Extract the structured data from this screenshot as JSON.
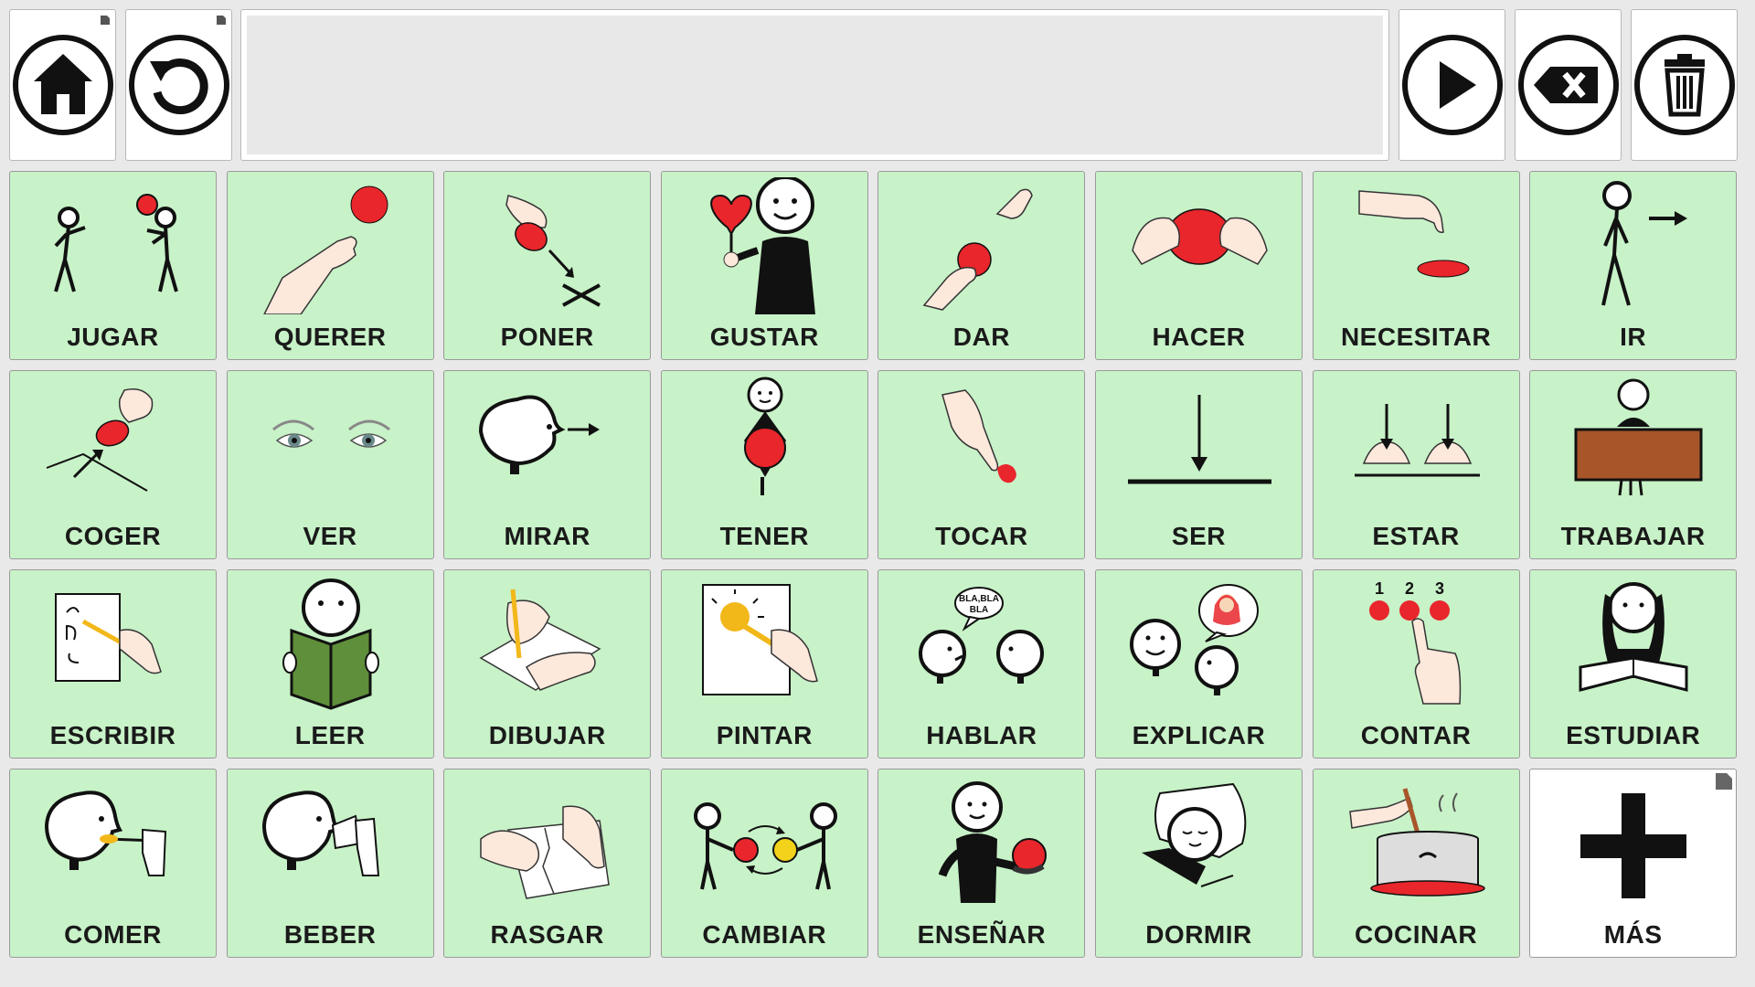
{
  "toolbar": {
    "home_icon": "home-icon",
    "back_icon": "undo-icon",
    "play_icon": "play-icon",
    "backspace_icon": "backspace-icon",
    "trash_icon": "trash-icon",
    "sentence_text": ""
  },
  "cells": [
    {
      "label": "JUGAR",
      "icon": "jugar-pictogram"
    },
    {
      "label": "QUERER",
      "icon": "querer-pictogram"
    },
    {
      "label": "PONER",
      "icon": "poner-pictogram"
    },
    {
      "label": "GUSTAR",
      "icon": "gustar-pictogram"
    },
    {
      "label": "DAR",
      "icon": "dar-pictogram"
    },
    {
      "label": "HACER",
      "icon": "hacer-pictogram"
    },
    {
      "label": "NECESITAR",
      "icon": "necesitar-pictogram"
    },
    {
      "label": "IR",
      "icon": "ir-pictogram"
    },
    {
      "label": "COGER",
      "icon": "coger-pictogram"
    },
    {
      "label": "VER",
      "icon": "ver-pictogram"
    },
    {
      "label": "MIRAR",
      "icon": "mirar-pictogram"
    },
    {
      "label": "TENER",
      "icon": "tener-pictogram"
    },
    {
      "label": "TOCAR",
      "icon": "tocar-pictogram"
    },
    {
      "label": "SER",
      "icon": "ser-pictogram"
    },
    {
      "label": "ESTAR",
      "icon": "estar-pictogram"
    },
    {
      "label": "TRABAJAR",
      "icon": "trabajar-pictogram"
    },
    {
      "label": "ESCRIBIR",
      "icon": "escribir-pictogram"
    },
    {
      "label": "LEER",
      "icon": "leer-pictogram"
    },
    {
      "label": "DIBUJAR",
      "icon": "dibujar-pictogram"
    },
    {
      "label": "PINTAR",
      "icon": "pintar-pictogram"
    },
    {
      "label": "HABLAR",
      "icon": "hablar-pictogram"
    },
    {
      "label": "EXPLICAR",
      "icon": "explicar-pictogram"
    },
    {
      "label": "CONTAR",
      "icon": "contar-pictogram"
    },
    {
      "label": "ESTUDIAR",
      "icon": "estudiar-pictogram"
    },
    {
      "label": "COMER",
      "icon": "comer-pictogram"
    },
    {
      "label": "BEBER",
      "icon": "beber-pictogram"
    },
    {
      "label": "RASGAR",
      "icon": "rasgar-pictogram"
    },
    {
      "label": "CAMBIAR",
      "icon": "cambiar-pictogram"
    },
    {
      "label": "ENSEÑAR",
      "icon": "ensenar-pictogram"
    },
    {
      "label": "DORMIR",
      "icon": "dormir-pictogram"
    },
    {
      "label": "COCINAR",
      "icon": "cocinar-pictogram"
    },
    {
      "label": "MÁS",
      "icon": "plus-icon"
    }
  ],
  "pictogram_text": {
    "bla": "BLA,BLA",
    "bla2": "BLA",
    "n1": "1",
    "n2": "2",
    "n3": "3"
  },
  "colors": {
    "cell_green": "#c8f2c8",
    "cell_white": "#ffffff",
    "accent_red": "#e8262b",
    "background": "#e9e9e9"
  }
}
